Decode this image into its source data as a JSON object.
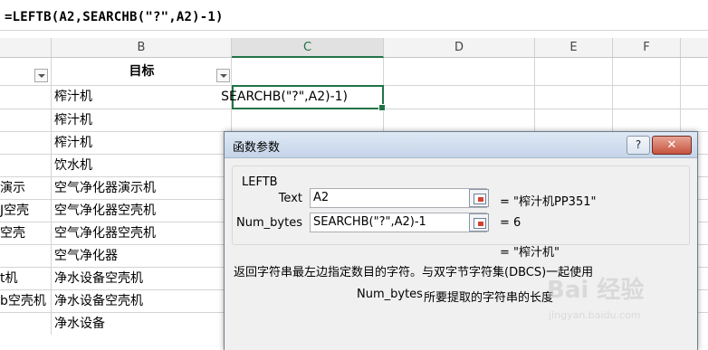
{
  "formula_bar": {
    "text": "=LEFTB(A2,SEARCHB(\"?\",A2)-1)"
  },
  "columns": [
    "B",
    "C",
    "D",
    "E",
    "F"
  ],
  "sheet": {
    "header_b": "目标",
    "active_cell_text": "SEARCHB(\"?\",A2)-1)",
    "col_a_fragments": [
      "",
      "",
      "",
      "",
      "演示",
      "J空壳",
      "空壳",
      "",
      "t机",
      "b空壳机",
      ""
    ],
    "col_b_values": [
      "榨汁机",
      "榨汁机",
      "榨汁机",
      "饮水机",
      "空气净化器演示机",
      "空气净化器空壳机",
      "空气净化器空壳机",
      "空气净化器",
      "净水设备空壳机",
      "净水设备空壳机",
      "净水设备"
    ]
  },
  "dialog": {
    "title": "函数参数",
    "help_label": "?",
    "close_label": "✕",
    "function_name": "LEFTB",
    "args": [
      {
        "label": "Text",
        "value": "A2",
        "result": "= \"榨汁机PP351\""
      },
      {
        "label": "Num_bytes",
        "value": "SEARCHB(\"?\",A2)-1",
        "result": "= 6"
      }
    ],
    "formula_result": "= \"榨汁机\"",
    "description": "返回字符串最左边指定数目的字符。与双字节字符集(DBCS)一起使用",
    "arg_help_name": "Num_bytes",
    "arg_help_text": "所要提取的字符串的长度"
  },
  "watermark": {
    "brand": "Bai 经验",
    "url": "jingyan.baidu.com"
  },
  "colors": {
    "accent": "#217346",
    "close": "#c6533e"
  }
}
